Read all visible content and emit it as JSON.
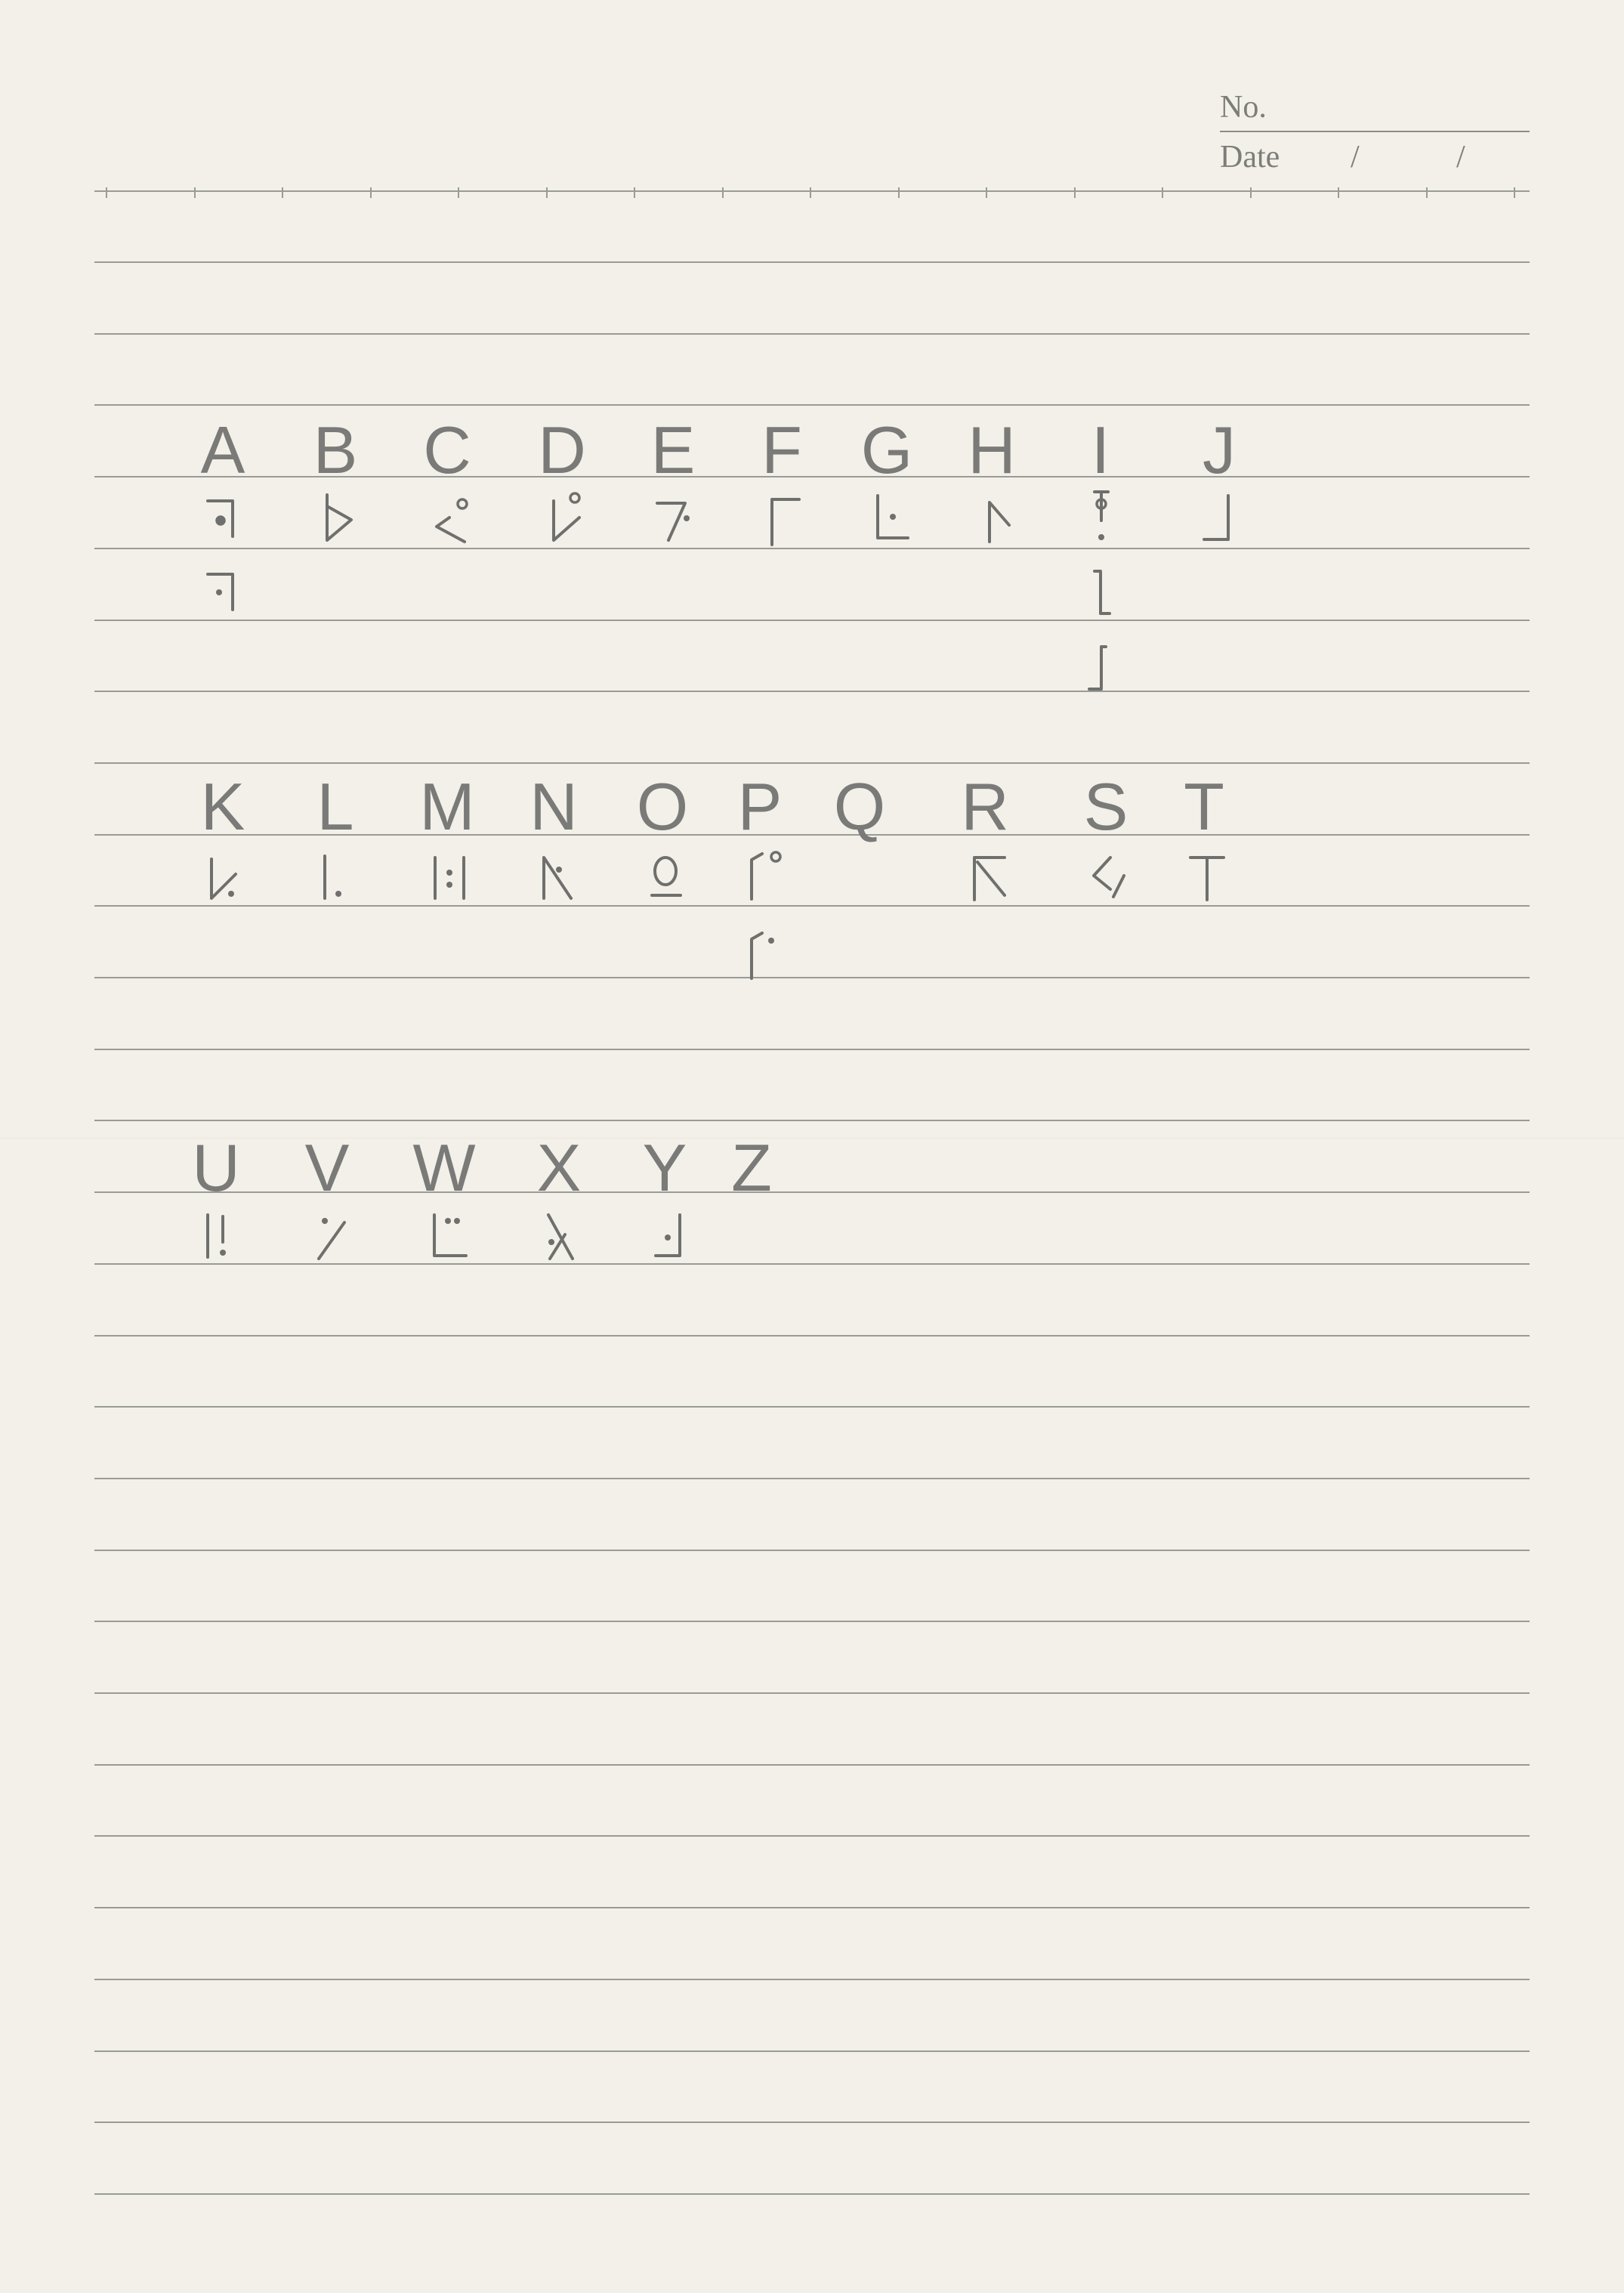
{
  "header": {
    "no_label": "No.",
    "date_label": "Date",
    "date_separator_1": "/",
    "date_separator_2": "/"
  },
  "letter_rows": [
    {
      "letters": [
        "A",
        "B",
        "C",
        "D",
        "E",
        "F",
        "G",
        "H",
        "I",
        "J"
      ]
    },
    {
      "letters": [
        "K",
        "L",
        "M",
        "N",
        "O",
        "P",
        "Q",
        "R",
        "S",
        "T"
      ]
    },
    {
      "letters": [
        "U",
        "V",
        "W",
        "X",
        "Y",
        "Z"
      ]
    }
  ],
  "glyph_icons": {
    "A": [
      "a-variant-1-icon",
      "a-variant-2-icon"
    ],
    "B": [
      "b-glyph-icon"
    ],
    "C": [
      "c-glyph-icon"
    ],
    "D": [
      "d-glyph-icon"
    ],
    "E": [
      "e-glyph-icon"
    ],
    "F": [
      "f-glyph-icon"
    ],
    "G": [
      "g-glyph-icon"
    ],
    "H": [
      "h-glyph-icon"
    ],
    "I": [
      "i-variant-1-icon",
      "i-variant-2-icon",
      "i-variant-3-icon"
    ],
    "J": [
      "j-glyph-icon"
    ],
    "K": [
      "k-glyph-icon"
    ],
    "L": [
      "l-glyph-icon"
    ],
    "M": [
      "m-glyph-icon"
    ],
    "N": [
      "n-glyph-icon"
    ],
    "O": [
      "o-glyph-icon"
    ],
    "P": [
      "p-variant-1-icon",
      "p-variant-2-icon"
    ],
    "R": [
      "r-glyph-icon"
    ],
    "S": [
      "s-glyph-icon"
    ],
    "T": [
      "t-glyph-icon"
    ],
    "U": [
      "u-glyph-icon"
    ],
    "V": [
      "v-glyph-icon"
    ],
    "W": [
      "w-glyph-icon"
    ],
    "X": [
      "x-glyph-icon"
    ],
    "Y": [
      "y-glyph-icon"
    ]
  },
  "colors": {
    "paper": "#f2f0e8",
    "rule": "#9a9a96",
    "pencil": "#6f6f6d"
  }
}
